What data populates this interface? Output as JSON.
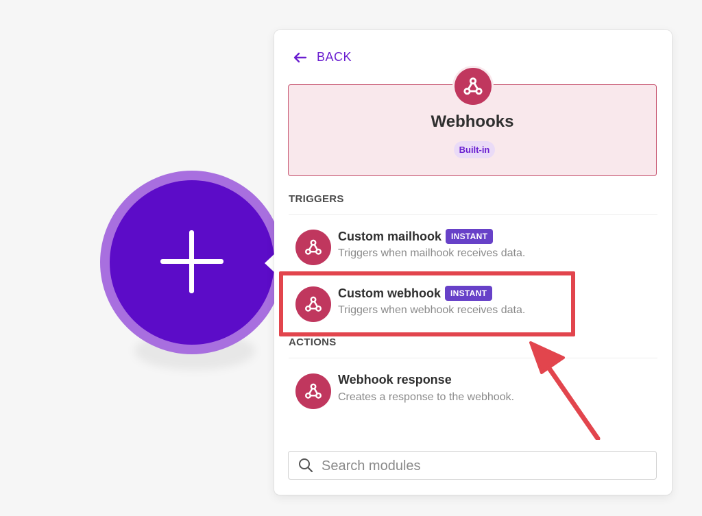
{
  "back": {
    "label": "BACK"
  },
  "app": {
    "name": "Webhooks",
    "badge": "Built-in"
  },
  "sections": {
    "triggers": "TRIGGERS",
    "actions": "ACTIONS"
  },
  "triggers": [
    {
      "title": "Custom mailhook",
      "badge": "INSTANT",
      "description": "Triggers when mailhook receives data."
    },
    {
      "title": "Custom webhook",
      "badge": "INSTANT",
      "description": "Triggers when webhook receives data."
    }
  ],
  "actions": [
    {
      "title": "Webhook response",
      "description": "Creates a response to the webhook."
    }
  ],
  "search": {
    "placeholder": "Search modules",
    "value": ""
  },
  "colors": {
    "accent": "#6a1fd0",
    "module_purple": "#5c0cc8",
    "app_red": "#c0375e",
    "highlight": "#e2454d",
    "instant_badge": "#6741c8"
  },
  "icons": [
    "arrow-left-icon",
    "webhook-icon",
    "search-icon",
    "plus-icon"
  ]
}
